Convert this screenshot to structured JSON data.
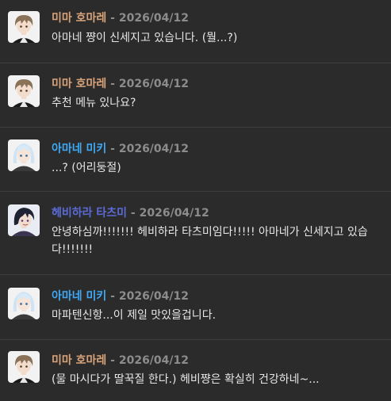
{
  "messages": [
    {
      "author": "미마 호마레",
      "separator": "-",
      "date": "2026/04/12",
      "text": "아마네 쨩이 신세지고 있습니다. (뭘...?)",
      "name_color": "#d9a37a",
      "avatar_icon": "brown-haired-boy-avatar-icon"
    },
    {
      "author": "미마 호마레",
      "separator": "-",
      "date": "2026/04/12",
      "text": "추천 메뉴 있나요?",
      "name_color": "#d9a37a",
      "avatar_icon": "brown-haired-boy-avatar-icon"
    },
    {
      "author": "아마네 미키",
      "separator": "-",
      "date": "2026/04/12",
      "text": "...? (어리둥절)",
      "name_color": "#3fa9f5",
      "avatar_icon": "white-haired-girl-avatar-icon"
    },
    {
      "author": "헤비하라 타츠미",
      "separator": "-",
      "date": "2026/04/12",
      "text": "안녕하심까!!!!!!! 헤비하라 타츠미임다!!!!! 아마네가 신세지고 있습다!!!!!!!",
      "name_color": "#5b6bd6",
      "avatar_icon": "dark-haired-boy-avatar-icon"
    },
    {
      "author": "아마네 미키",
      "separator": "-",
      "date": "2026/04/12",
      "text": "마파텐신항...이 제일 맛있을겁니다.",
      "name_color": "#3fa9f5",
      "avatar_icon": "white-haired-girl-avatar-icon"
    },
    {
      "author": "미마 호마레",
      "separator": "-",
      "date": "2026/04/12",
      "text": "(물 마시다가 딸꾹질 한다.) 헤비쨩은 확실히 건강하네~...",
      "name_color": "#d9a37a",
      "avatar_icon": "brown-haired-boy-avatar-icon"
    }
  ]
}
